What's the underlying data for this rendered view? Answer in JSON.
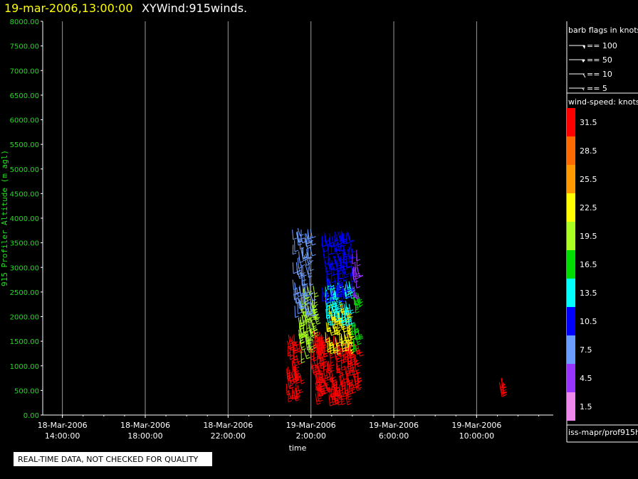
{
  "header": {
    "datetime": "19-mar-2006,13:00:00",
    "product": "XYWind:915winds."
  },
  "chart_data": {
    "type": "scatter",
    "xlabel": "time",
    "ylabel": "915 Profiler Altitude (m agl)",
    "y_ticks": [
      "0.00",
      "500.00",
      "1000.00",
      "1500.00",
      "2000.00",
      "2500.00",
      "3000.00",
      "3500.00",
      "4000.00",
      "4500.00",
      "5000.00",
      "5500.00",
      "6000.00",
      "6500.00",
      "7000.00",
      "7500.00",
      "8000.00"
    ],
    "ylim": [
      0,
      8000
    ],
    "x_ticks": [
      {
        "date": "18-Mar-2006",
        "time": "14:00:00"
      },
      {
        "date": "18-Mar-2006",
        "time": "18:00:00"
      },
      {
        "date": "18-Mar-2006",
        "time": "22:00:00"
      },
      {
        "date": "19-Mar-2006",
        "time": "2:00:00"
      },
      {
        "date": "19-Mar-2006",
        "time": "6:00:00"
      },
      {
        "date": "19-Mar-2006",
        "time": "10:00:00"
      }
    ],
    "x_hours_range": [
      13.05,
      37.7
    ],
    "grid": "vertical",
    "barb_clusters": [
      {
        "t_start": 24.8,
        "t_end": 25.5,
        "alt_low": 450,
        "alt_high": 1650,
        "speed": 31.5
      },
      {
        "t_start": 25.4,
        "t_end": 26.2,
        "alt_low": 1300,
        "alt_high": 2700,
        "speed": 19.5
      },
      {
        "t_start": 25.1,
        "t_end": 26.0,
        "alt_low": 2200,
        "alt_high": 3800,
        "speed": 7.5
      },
      {
        "t_start": 26.0,
        "t_end": 26.6,
        "alt_low": 800,
        "alt_high": 1750,
        "speed": 31.5
      },
      {
        "t_start": 26.2,
        "t_end": 27.8,
        "alt_low": 400,
        "alt_high": 1700,
        "speed": 31.5
      },
      {
        "t_start": 26.7,
        "t_end": 27.9,
        "alt_low": 1400,
        "alt_high": 2300,
        "speed": 22.5
      },
      {
        "t_start": 26.7,
        "t_end": 27.9,
        "alt_low": 2000,
        "alt_high": 2800,
        "speed": 13.5
      },
      {
        "t_start": 26.5,
        "t_end": 28.0,
        "alt_low": 2500,
        "alt_high": 3750,
        "speed": 10.5
      },
      {
        "t_start": 27.8,
        "t_end": 28.3,
        "alt_low": 600,
        "alt_high": 1500,
        "speed": 31.5
      },
      {
        "t_start": 28.0,
        "t_end": 28.3,
        "alt_low": 1500,
        "alt_high": 2500,
        "speed": 16.5
      },
      {
        "t_start": 28.0,
        "t_end": 28.3,
        "alt_low": 2500,
        "alt_high": 3400,
        "speed": 4.5
      },
      {
        "t_start": 35.1,
        "t_end": 35.3,
        "alt_low": 500,
        "alt_high": 800,
        "speed": 31.5
      }
    ]
  },
  "legend": {
    "barb_title": "barb flags in knots",
    "barbs": [
      "== 100",
      "== 50",
      "== 10",
      "== 5"
    ],
    "speed_title": "wind-speed: knots",
    "bins": [
      {
        "label": "31.5",
        "color": "#ff0000"
      },
      {
        "label": "28.5",
        "color": "#ff6a00"
      },
      {
        "label": "25.5",
        "color": "#ff9900"
      },
      {
        "label": "22.5",
        "color": "#ffff00"
      },
      {
        "label": "19.5",
        "color": "#aaff22"
      },
      {
        "label": "16.5",
        "color": "#00dd00"
      },
      {
        "label": "13.5",
        "color": "#00ffff"
      },
      {
        "label": "10.5",
        "color": "#0000ff"
      },
      {
        "label": "7.5",
        "color": "#6b9cff"
      },
      {
        "label": "4.5",
        "color": "#9933ff"
      },
      {
        "label": "1.5",
        "color": "#ee88ee"
      }
    ],
    "source": "iss-mapr/prof915h"
  },
  "footer": {
    "note": "REAL-TIME DATA, NOT CHECKED FOR QUALITY"
  }
}
